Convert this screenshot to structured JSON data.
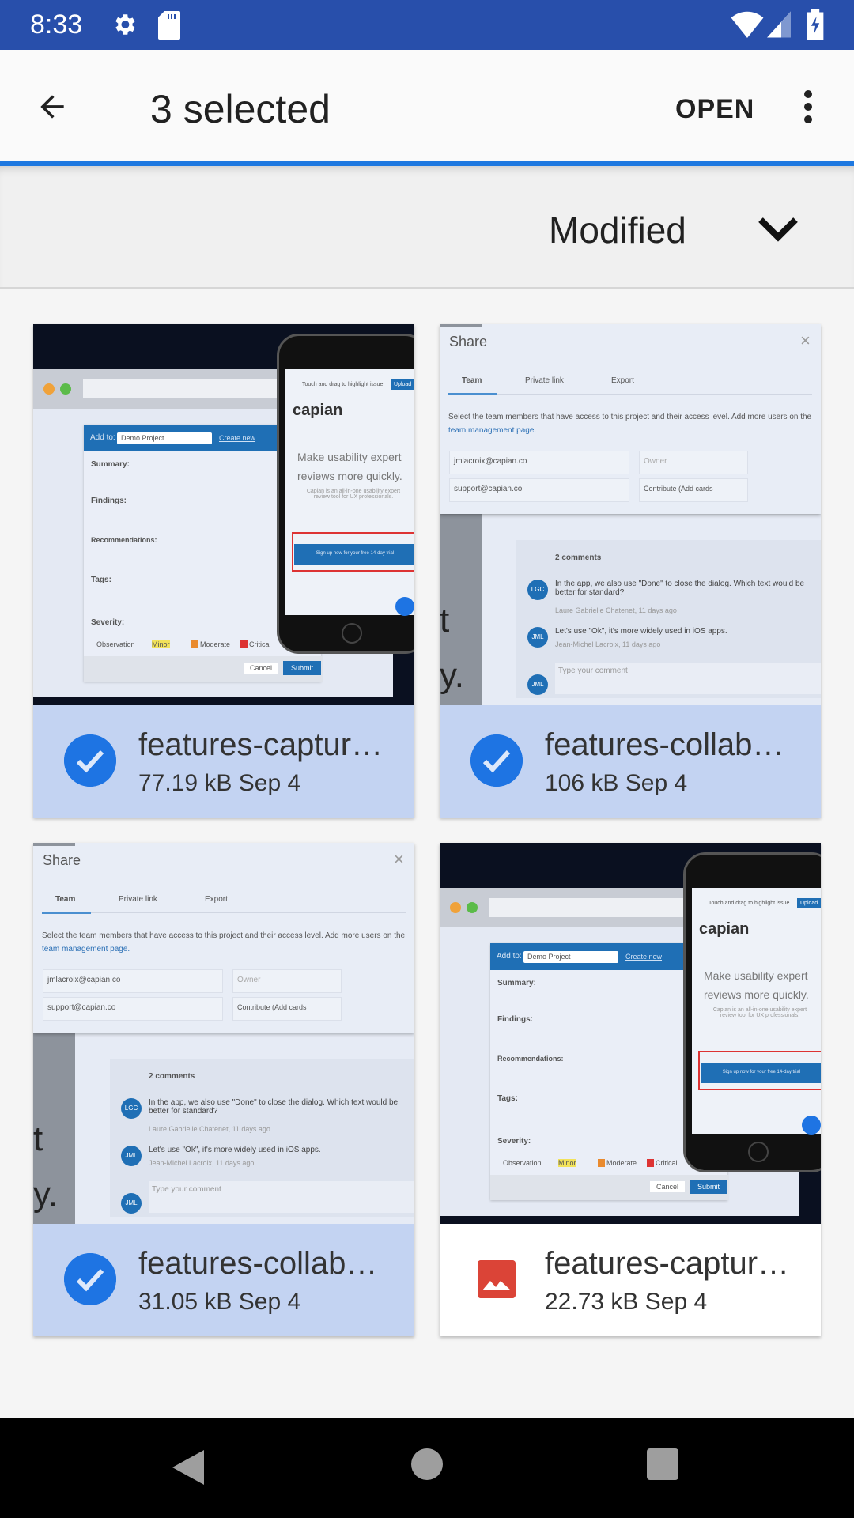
{
  "status_bar": {
    "time": "8:33",
    "icons": [
      "settings-icon",
      "sd-card-icon",
      "wifi-icon",
      "signal-icon",
      "battery-charging-icon"
    ],
    "color": "#284fab"
  },
  "app_bar": {
    "title": "3 selected",
    "open_label": "OPEN",
    "icons": [
      "back-arrow-icon",
      "more-vert-icon"
    ],
    "accent": "#1e78e0"
  },
  "sort": {
    "label": "Modified",
    "icon": "chevron-down-icon"
  },
  "files": [
    {
      "name": "features-captur…",
      "size": "77.19 kB",
      "date": "Sep 4",
      "selected": true,
      "thumb": "capture"
    },
    {
      "name": "features-collab…",
      "size": "106 kB",
      "date": "Sep 4",
      "selected": true,
      "thumb": "collab"
    },
    {
      "name": "features-collab…",
      "size": "31.05 kB",
      "date": "Sep 4",
      "selected": true,
      "thumb": "collab"
    },
    {
      "name": "features-captur…",
      "size": "22.73 kB",
      "date": "Sep 4",
      "selected": false,
      "thumb": "capture"
    }
  ],
  "thumbs": {
    "capture": {
      "add_to": "Add to:",
      "project": "Demo Project",
      "create": "Create new",
      "summary": "Summary:",
      "findings": "Findings:",
      "recommendations": "Recommendations:",
      "tags": "Tags:",
      "severity": "Severity:",
      "sev": [
        "Observation",
        "Minor",
        "Moderate",
        "Critical"
      ],
      "cancel": "Cancel",
      "submit": "Submit",
      "brand": "capian",
      "headline1": "Make usability expert",
      "headline2": "reviews more quickly.",
      "blurb": "Capian is an all-in-one usability expert review tool for UX professionals.",
      "cta": "Sign up now for your free 14-day trial",
      "touch": "Touch and drag to highlight issue.",
      "upload": "Upload"
    },
    "collab": {
      "title": "Share",
      "tabs": [
        "Team",
        "Private link",
        "Export"
      ],
      "desc": "Select the team members that have access to this project and their access level. Add more users on the",
      "desc_link": "team management page.",
      "email1": "jmlacroix@capian.co",
      "role1": "Owner",
      "email2": "support@capian.co",
      "role2": "Contribute (Add cards",
      "comments": "2 comments",
      "c1": "In the app, we also use \"Done\" to close the dialog. Which text would be better for standard?",
      "c1_author": "Laure Gabrielle Chatenet, 11 days ago",
      "c2": "Let's use \"Ok\", it's more widely used in iOS apps.",
      "c2_author": "Jean-Michel Lacroix, 11 days ago",
      "placeholder": "Type your comment",
      "av1": "LGC",
      "av2": "JML"
    }
  },
  "nav_bar": {
    "icons": [
      "back-triangle-icon",
      "home-circle-icon",
      "recents-square-icon"
    ]
  }
}
